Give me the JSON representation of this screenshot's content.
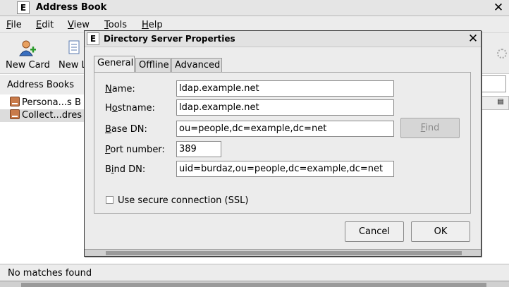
{
  "window": {
    "icon_letter": "E",
    "title": "Address Book"
  },
  "menubar": [
    {
      "label": "File",
      "key": "F",
      "rest": "ile"
    },
    {
      "label": "Edit",
      "key": "E",
      "rest": "dit"
    },
    {
      "label": "View",
      "key": "V",
      "rest": "iew"
    },
    {
      "label": "Tools",
      "key": "T",
      "rest": "ools"
    },
    {
      "label": "Help",
      "key": "H",
      "rest": "elp"
    }
  ],
  "toolbar": {
    "new_card": "New Card",
    "new_list": "New L"
  },
  "address_books": {
    "header": "Address Books",
    "items": [
      "Persona...s B",
      "Collect...dres"
    ]
  },
  "status": {
    "message": "No matches found"
  },
  "dialog": {
    "icon_letter": "E",
    "title": "Directory Server Properties",
    "tabs": [
      "General",
      "Offline",
      "Advanced"
    ],
    "active_tab": "General",
    "fields": {
      "name": {
        "key": "N",
        "rest": "ame:",
        "value": "ldap.example.net"
      },
      "hostname": {
        "pre": "H",
        "key": "o",
        "rest": "stname:",
        "value": "ldap.example.net"
      },
      "base_dn": {
        "key": "B",
        "rest": "ase DN:",
        "value": "ou=people,dc=example,dc=net"
      },
      "port": {
        "key": "P",
        "rest": "ort number:",
        "value": "389"
      },
      "bind_dn": {
        "pre": "B",
        "key": "i",
        "rest": "nd DN:",
        "value": "uid=burdaz,ou=people,dc=example,dc=net"
      }
    },
    "find": {
      "key": "F",
      "rest": "ind"
    },
    "ssl": {
      "label": "Use secure connection (SSL)",
      "checked": false
    },
    "buttons": {
      "cancel": "Cancel",
      "ok": "OK"
    }
  }
}
